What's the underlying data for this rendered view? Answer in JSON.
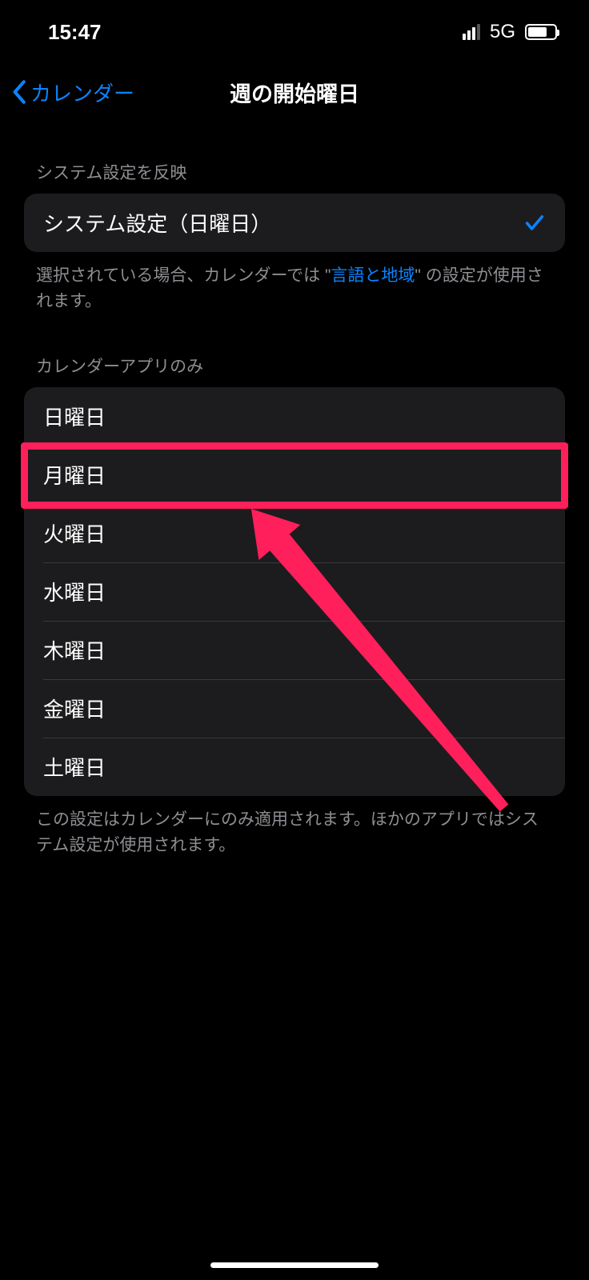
{
  "status": {
    "time": "15:47",
    "network": "5G"
  },
  "nav": {
    "back_label": "カレンダー",
    "title": "週の開始曜日"
  },
  "section1": {
    "header": "システム設定を反映",
    "item_label": "システム設定（日曜日）",
    "footer_pre": "選択されている場合、カレンダーでは \"",
    "footer_link": "言語と地域",
    "footer_post": "\" の設定が使用されます。"
  },
  "section2": {
    "header": "カレンダーアプリのみ",
    "days": [
      "日曜日",
      "月曜日",
      "火曜日",
      "水曜日",
      "木曜日",
      "金曜日",
      "土曜日"
    ],
    "footer": "この設定はカレンダーにのみ適用されます。ほかのアプリではシステム設定が使用されます。"
  },
  "annotation": {
    "highlighted_index": 1
  }
}
